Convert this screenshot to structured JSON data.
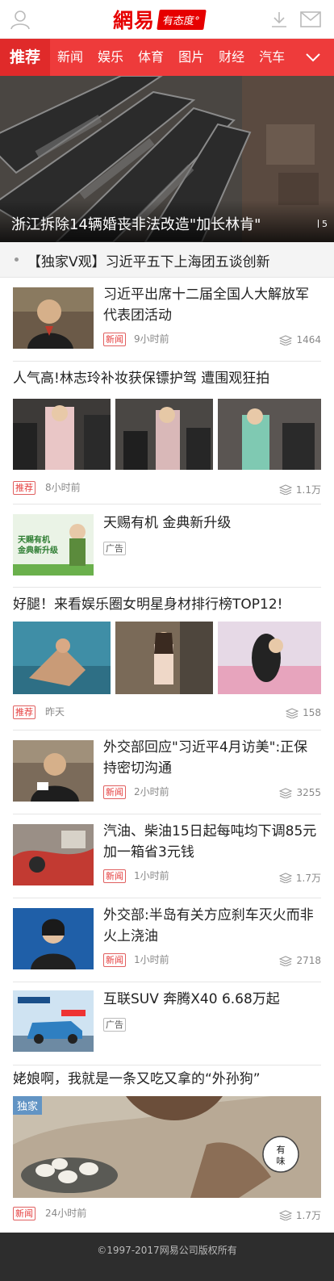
{
  "header": {
    "logo_text": "網易",
    "logo_tag": "有态度°"
  },
  "nav": {
    "items": [
      "推荐",
      "新闻",
      "娱乐",
      "体育",
      "图片",
      "财经",
      "汽车"
    ]
  },
  "hero": {
    "caption": "浙江拆除14辆婚丧非法改造\"加长林肯\"",
    "page": "5"
  },
  "ticker": {
    "text": "【独家V观】习近平五下上海团五谈创新"
  },
  "items": [
    {
      "title": "习近平出席十二届全国人大解放军代表团活动",
      "badge": "新闻",
      "time": "9小时前",
      "comments": "1464"
    },
    {
      "title": "人气高!林志玲补妆获保镖护驾  遭围观狂拍",
      "badge": "推荐",
      "time": "8小时前",
      "comments": "1.1万"
    },
    {
      "title": "天赐有机  金典新升级",
      "badge": "广告",
      "ad_text_1": "天赐有机",
      "ad_text_2": "金典新升级"
    },
    {
      "title": "好腿！来看娱乐圈女明星身材排行榜TOP12!",
      "badge": "推荐",
      "time": "昨天",
      "comments": "158"
    },
    {
      "title": "外交部回应\"习近平4月访美\":正保持密切沟通",
      "badge": "新闻",
      "time": "2小时前",
      "comments": "3255"
    },
    {
      "title": "汽油、柴油15日起每吨均下调85元  加一箱省3元钱",
      "badge": "新闻",
      "time": "1小时前",
      "comments": "1.7万"
    },
    {
      "title": "外交部:半岛有关方应刹车灭火而非火上浇油",
      "badge": "新闻",
      "time": "1小时前",
      "comments": "2718"
    },
    {
      "title": "互联SUV  奔腾X40  6.68万起",
      "badge": "广告"
    },
    {
      "title": "姥娘啊，我就是一条又吃又拿的“外孙狗”",
      "badge": "新闻",
      "time": "24小时前",
      "comments": "1.7万",
      "corner_tag": "独家"
    }
  ],
  "footer": {
    "copyright": "©1997-2017网易公司版权所有"
  },
  "colors": {
    "brand_red": "#ee3b3b",
    "badge_red": "#e63c3c"
  }
}
